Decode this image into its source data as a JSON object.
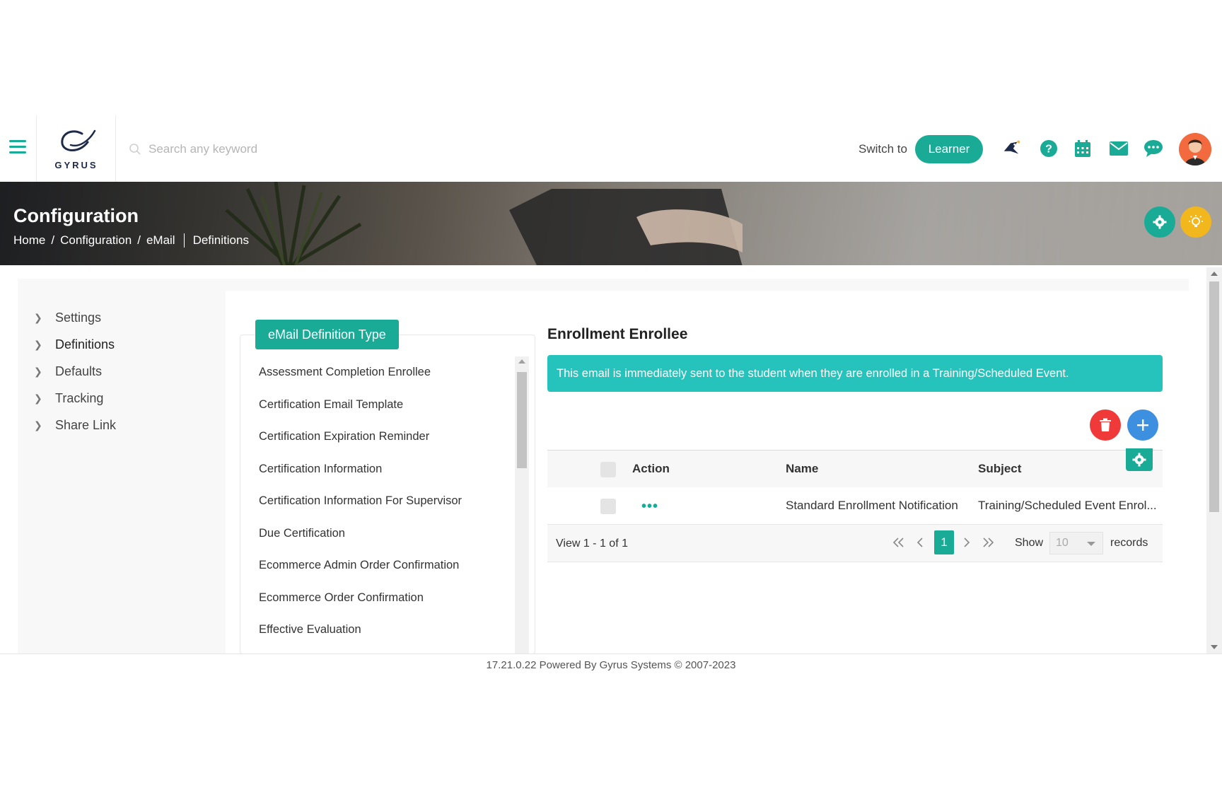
{
  "header": {
    "logo_text": "GYRUS",
    "search_placeholder": "Search any keyword",
    "switch_label": "Switch to",
    "learner_label": "Learner"
  },
  "banner": {
    "title": "Configuration",
    "breadcrumb": [
      "Home",
      "Configuration",
      "eMail",
      "Definitions"
    ]
  },
  "sidebar": {
    "items": [
      {
        "label": "Settings"
      },
      {
        "label": "Definitions"
      },
      {
        "label": "Defaults"
      },
      {
        "label": "Tracking"
      },
      {
        "label": "Share Link"
      }
    ]
  },
  "definition_types": {
    "tab_label": "eMail Definition Type",
    "items": [
      "Assessment Completion Enrollee",
      "Certification Email Template",
      "Certification Expiration Reminder",
      "Certification Information",
      "Certification Information For Supervisor",
      "Due Certification",
      "Ecommerce Admin Order Confirmation",
      "Ecommerce Order Confirmation",
      "Effective Evaluation"
    ]
  },
  "detail": {
    "title": "Enrollment Enrollee",
    "description": "This email is immediately sent to the student when they are enrolled in a Training/Scheduled Event.",
    "columns": {
      "action": "Action",
      "name": "Name",
      "subject": "Subject"
    },
    "rows": [
      {
        "action": "•••",
        "name": "Standard Enrollment Notification",
        "subject": "Training/Scheduled Event Enrol..."
      }
    ],
    "footer": {
      "view_text": "View 1 - 1 of 1",
      "current_page": "1",
      "show_label": "Show",
      "page_size": "10",
      "records_label": "records"
    }
  },
  "footer_text": "17.21.0.22 Powered By Gyrus Systems © 2007-2023",
  "colors": {
    "accent": "#1aab96",
    "alert": "#26c3bd",
    "delete": "#f03a3a",
    "add": "#3d8fe0",
    "idea": "#f3b71e"
  }
}
